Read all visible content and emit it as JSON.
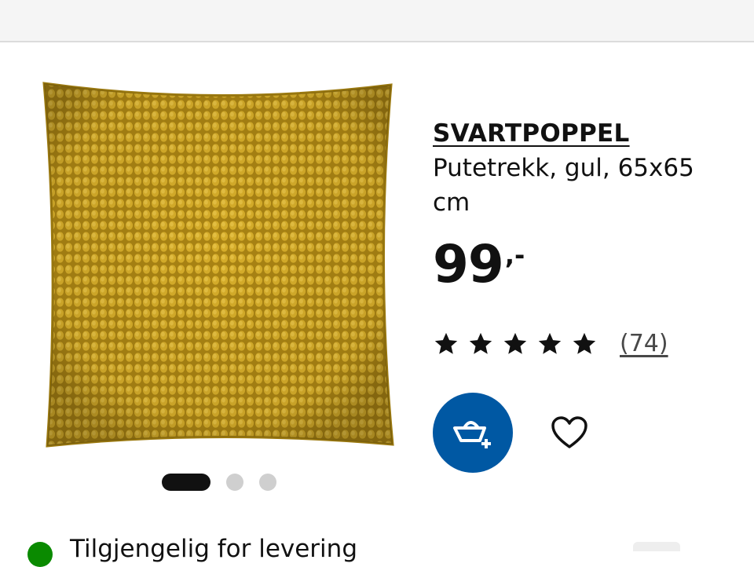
{
  "product": {
    "name": "SVARTPOPPEL",
    "description": "Putetrekk, gul, 65x65 cm",
    "price_integer": "99",
    "price_decimal": ",-",
    "rating_stars": 5,
    "rating_count": "(74)"
  },
  "actions": {
    "cart_icon": "add-to-cart-icon",
    "wishlist_icon": "heart-icon"
  },
  "carousel": {
    "total_images": 3,
    "active_index": 0
  },
  "availability": {
    "text": "Tilgjengelig for levering"
  },
  "colors": {
    "accent_blue": "#0058a3",
    "status_green": "#0a8a00",
    "cushion_yellow": "#c9a21f"
  }
}
